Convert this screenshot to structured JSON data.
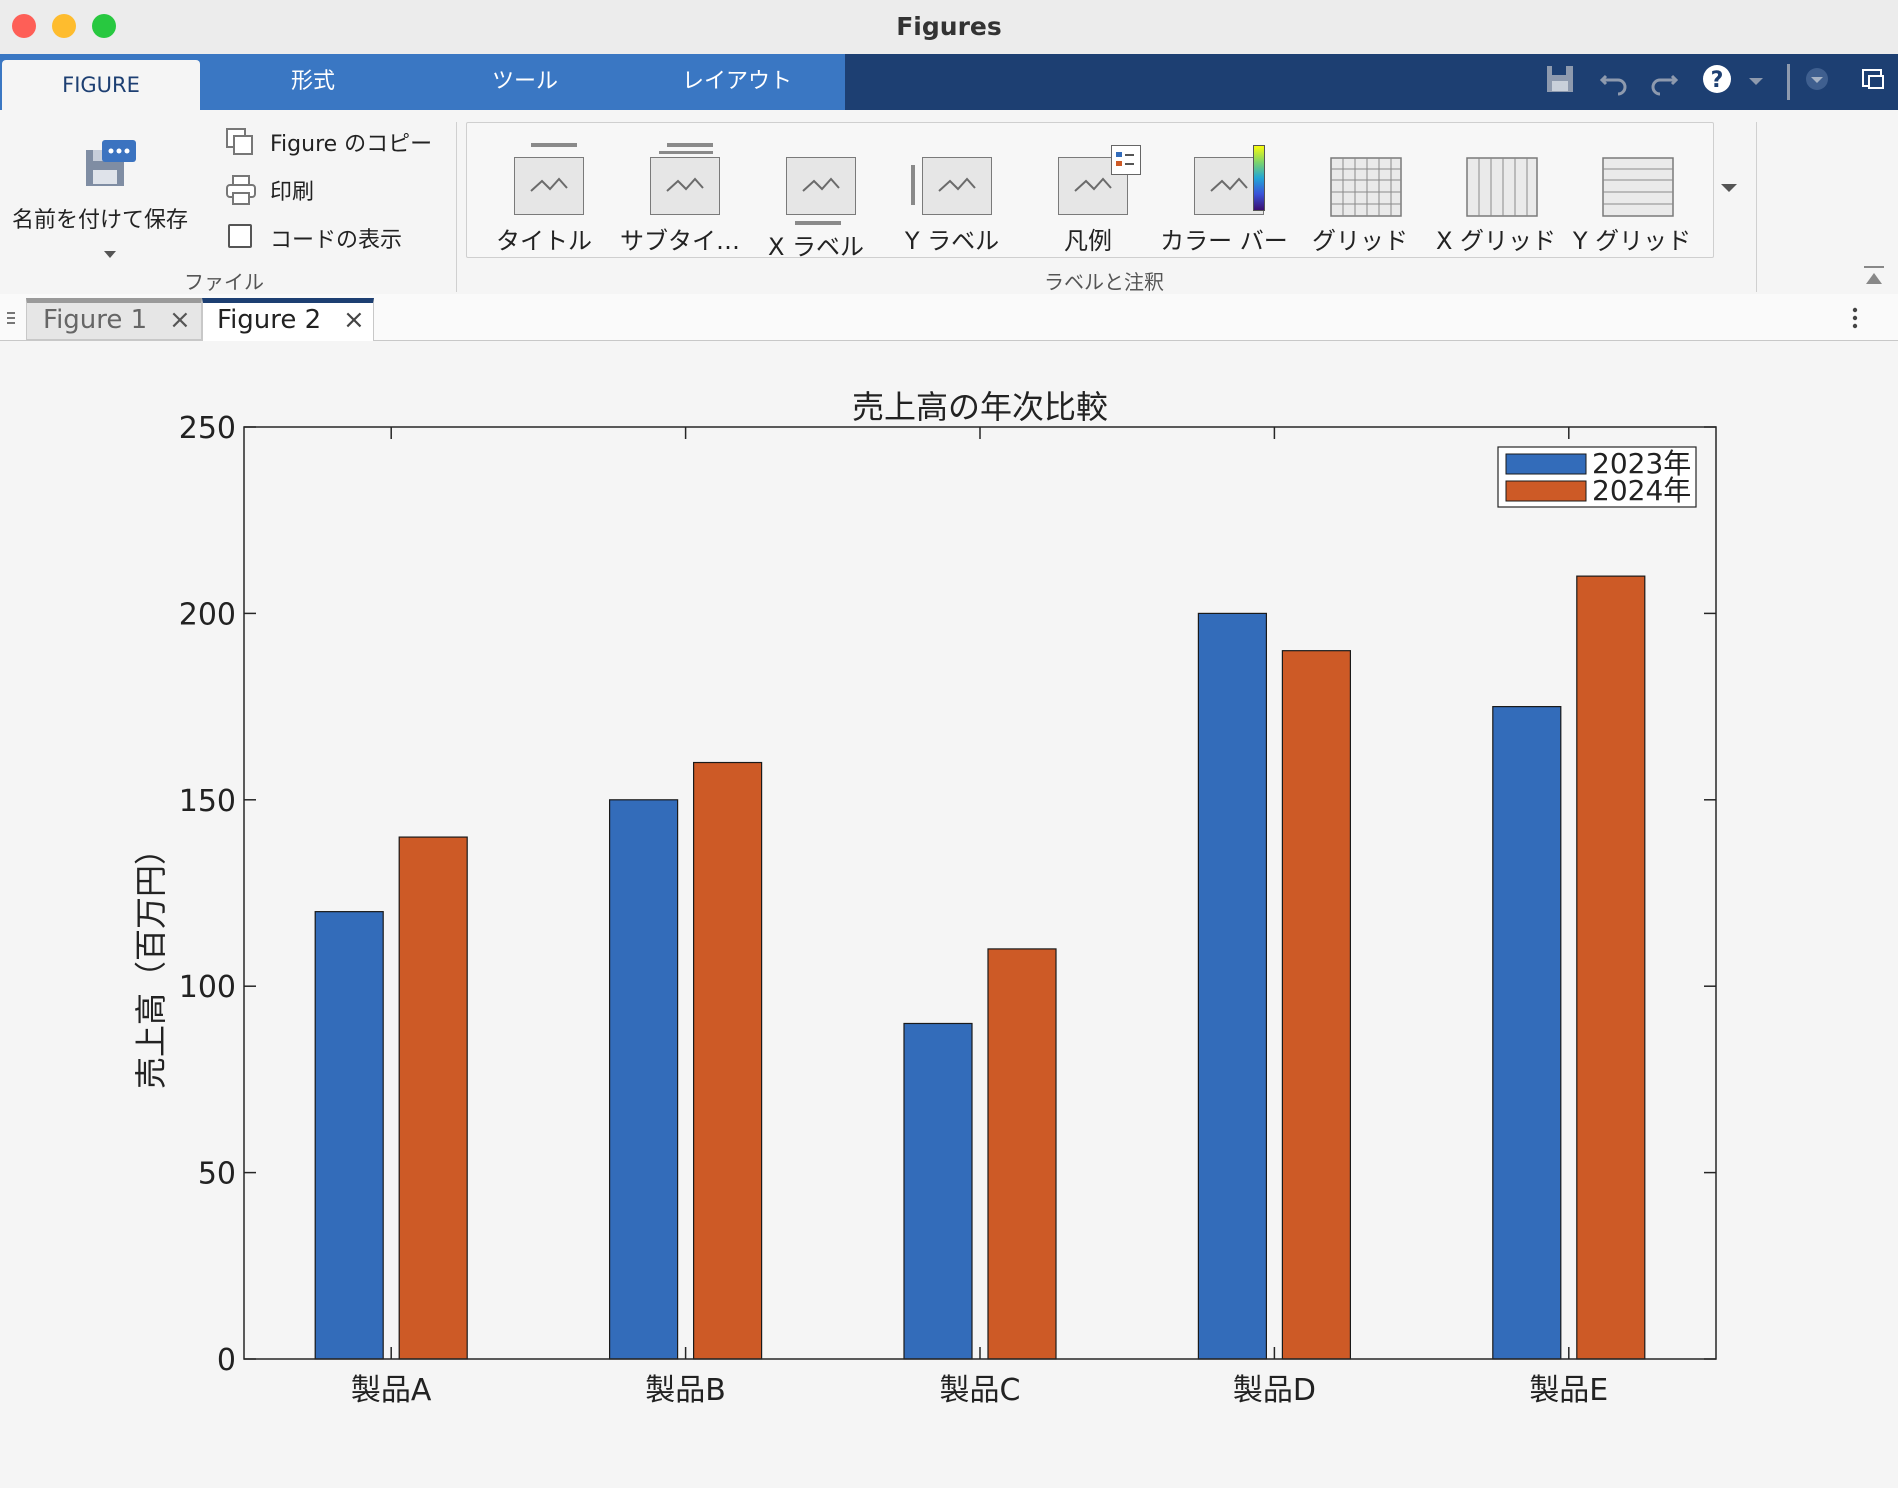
{
  "window": {
    "title": "Figures"
  },
  "ribbon_tabs": [
    {
      "label": "FIGURE",
      "active": true
    },
    {
      "label": "形式"
    },
    {
      "label": "ツール"
    },
    {
      "label": "レイアウト"
    }
  ],
  "file_group": {
    "save_as_label": "名前を付けて保存",
    "copy_figure_label": "Figure のコピー",
    "print_label": "印刷",
    "show_code_label": "コードの表示",
    "group_label": "ファイル"
  },
  "labels_group": {
    "group_label": "ラベルと注釈",
    "items": [
      {
        "label": "タイトル",
        "icon": "title-icon"
      },
      {
        "label": "サブタイ…",
        "icon": "subtitle-icon"
      },
      {
        "label": "X ラベル",
        "icon": "xlabel-icon"
      },
      {
        "label": "Y ラベル",
        "icon": "ylabel-icon"
      },
      {
        "label": "凡例",
        "icon": "legend-icon"
      },
      {
        "label": "カラー バー",
        "icon": "colorbar-icon"
      },
      {
        "label": "グリッド",
        "icon": "grid-icon"
      },
      {
        "label": "X グリッド",
        "icon": "xgrid-icon"
      },
      {
        "label": "Y グリッド",
        "icon": "ygrid-icon"
      }
    ]
  },
  "doc_tabs": [
    {
      "label": "Figure 1",
      "active": false
    },
    {
      "label": "Figure 2",
      "active": true
    }
  ],
  "colors": {
    "series1": "#336cba",
    "series2": "#cd5a26",
    "ribbon_dark": "#1d3f72",
    "ribbon_tab": "#3a77c3"
  },
  "chart_data": {
    "type": "bar",
    "title": "売上高の年次比較",
    "xlabel": "",
    "ylabel": "売上高（百万円）",
    "categories": [
      "製品A",
      "製品B",
      "製品C",
      "製品D",
      "製品E"
    ],
    "series": [
      {
        "name": "2023年",
        "values": [
          120,
          150,
          90,
          200,
          175
        ]
      },
      {
        "name": "2024年",
        "values": [
          140,
          160,
          110,
          190,
          210
        ]
      }
    ],
    "ylim": [
      0,
      250
    ],
    "yticks": [
      0,
      50,
      100,
      150,
      200,
      250
    ],
    "grid": false,
    "legend_position": "top-right"
  }
}
